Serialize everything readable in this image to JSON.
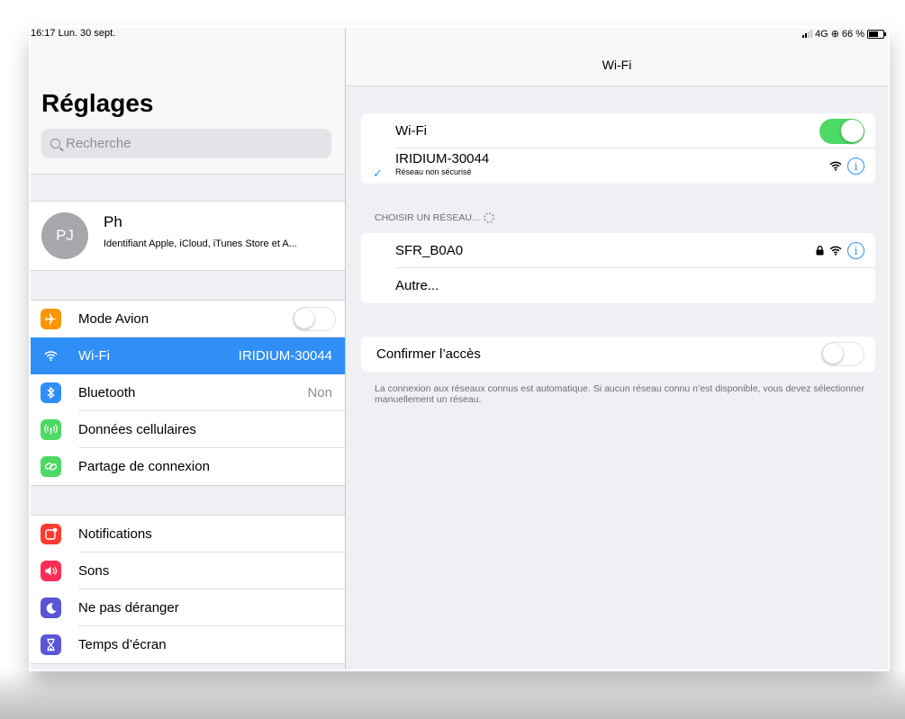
{
  "status_bar": {
    "time_date": "16:17  Lun. 30 sept.",
    "network": "4G",
    "battery": "66 %"
  },
  "sidebar": {
    "title": "Réglages",
    "search_placeholder": "Recherche",
    "profile": {
      "initials": "PJ",
      "name": "Ph",
      "subtitle": "Identifiant Apple, iCloud, iTunes Store et A..."
    },
    "group1": [
      {
        "label": "Mode Avion",
        "icon": "airplane-icon",
        "color": "#ff9500",
        "control": "toggle-off"
      },
      {
        "label": "Wi-Fi",
        "icon": "wifi-icon",
        "color": "#2f8ff7",
        "value": "IRIDIUM-30044",
        "selected": true
      },
      {
        "label": "Bluetooth",
        "icon": "bluetooth-icon",
        "color": "#2f8ff7",
        "value": "Non"
      },
      {
        "label": "Données cellulaires",
        "icon": "cellular-icon",
        "color": "#4cd964"
      },
      {
        "label": "Partage de connexion",
        "icon": "hotspot-icon",
        "color": "#4cd964"
      }
    ],
    "group2": [
      {
        "label": "Notifications",
        "icon": "notifications-icon",
        "color": "#ff3b30"
      },
      {
        "label": "Sons",
        "icon": "sounds-icon",
        "color": "#ff2d55"
      },
      {
        "label": "Ne pas déranger",
        "icon": "moon-icon",
        "color": "#5856d6"
      },
      {
        "label": "Temps d’écran",
        "icon": "hourglass-icon",
        "color": "#5856d6"
      }
    ]
  },
  "detail": {
    "nav_title": "Wi-Fi",
    "wifi_label": "Wi-Fi",
    "wifi_on": true,
    "connected": {
      "name": "IRIDIUM-30044",
      "subtitle": "Réseau non sécurisé"
    },
    "choose_header": "CHOISIR UN RÉSEAU...",
    "networks": [
      {
        "name": "SFR_B0A0",
        "secured": true
      }
    ],
    "other_label": "Autre...",
    "confirm_label": "Confirmer l’accès",
    "confirm_on": false,
    "footer": "La connexion aux réseaux connus est automatique. Si aucun réseau connu n’est disponible, vous devez sélectionner manuellement un réseau."
  },
  "colors": {
    "accent": "#2f8ff7",
    "toggle_on": "#4cd964"
  }
}
